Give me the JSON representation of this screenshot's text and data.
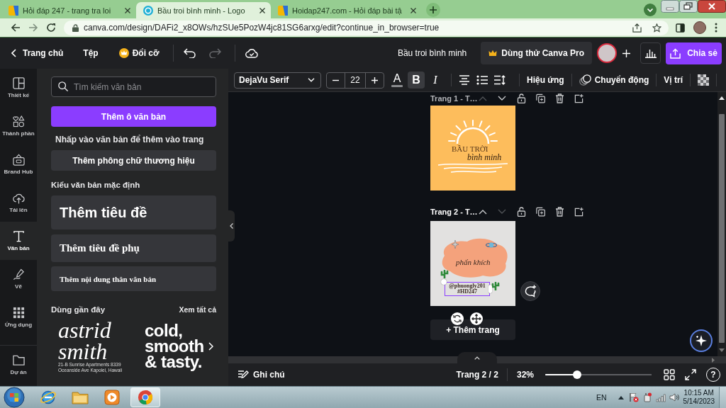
{
  "browser": {
    "tabs": [
      {
        "title": "Hỏi đáp 247 - trang tra loi",
        "selected": false
      },
      {
        "title": "Bầu troi bình minh - Logo",
        "selected": true
      },
      {
        "title": "Hoidap247.com - Hỏi đáp bài tậ",
        "selected": false
      }
    ],
    "url": "canva.com/design/DAFi2_x8OWs/hzSUe5PozW4jc81SG6arxg/edit?continue_in_browser=true"
  },
  "header": {
    "home": "Trang chủ",
    "file": "Tệp",
    "resize": "Đổi cỡ",
    "design_title": "Bầu troi bình minh",
    "pro_button": "Dùng thử Canva Pro",
    "share_button": "Chia sẻ"
  },
  "rail": [
    {
      "label": "Thiết kế",
      "selected": false
    },
    {
      "label": "Thành phần",
      "selected": false
    },
    {
      "label": "Brand Hub",
      "selected": false
    },
    {
      "label": "Tải lên",
      "selected": false
    },
    {
      "label": "Văn bản",
      "selected": true
    },
    {
      "label": "Vẽ",
      "selected": false
    },
    {
      "label": "Ứng dụng",
      "selected": false
    },
    {
      "label": "Dự án",
      "selected": false
    }
  ],
  "panel": {
    "search": {
      "placeholder": "Tìm kiếm văn bản"
    },
    "add_textbox": "Thêm ô văn bản",
    "hint": "Nhấp vào văn bản để thêm vào trang",
    "brand_fonts": "Thêm phông chữ thương hiệu",
    "defaults_heading": "Kiểu văn bản mặc định",
    "styles": [
      {
        "kind": "heading",
        "label": "Thêm tiêu đề"
      },
      {
        "kind": "subheading",
        "label": "Thêm tiêu đề phụ"
      },
      {
        "kind": "body",
        "label": "Thêm nội dung thân văn bản"
      }
    ],
    "recent_heading": "Dùng gần đây",
    "see_all": "Xem tất cả",
    "recent": [
      {
        "kind": "serif",
        "lines": [
          "astrid",
          "smith"
        ],
        "note": [
          "21-B Sunrise Apartments 8339",
          "Oceanside Ave Kapolei, Hawaii"
        ]
      },
      {
        "kind": "sans",
        "lines": [
          "cold,",
          "smooth",
          "& tasty."
        ]
      }
    ]
  },
  "toolbar": {
    "font": "DejaVu Serif",
    "size": "22",
    "format": [
      {
        "kind": "color",
        "glyph": "A",
        "selected": false
      },
      {
        "kind": "bold",
        "glyph": "B",
        "selected": true
      },
      {
        "kind": "italic",
        "glyph": "I",
        "selected": false
      }
    ],
    "effects": "Hiệu ứng",
    "animate": "Chuyển động",
    "position": "Vị trí"
  },
  "pages": [
    {
      "label": "Trang 1 - T…",
      "selected": false,
      "design": {
        "kind": "sunrise",
        "title": "BẦU TRỜI",
        "subtitle": "bình minh"
      }
    },
    {
      "label": "Trang 2 - T…",
      "selected": true,
      "design": {
        "kind": "watercolor",
        "title": "phấn khích",
        "caption": [
          "@phuongly201",
          "#HD247"
        ],
        "caption_selected": true
      }
    }
  ],
  "add_page": "+ Thêm trang",
  "footer": {
    "notes": "Ghi chú",
    "page_counter": "Trang 2 / 2",
    "zoom": "32%",
    "zoom_slider": {
      "level": 0.3
    },
    "help": "?"
  },
  "taskbar": {
    "language": "EN",
    "time": "10:15 AM",
    "date": "5/14/2023"
  }
}
